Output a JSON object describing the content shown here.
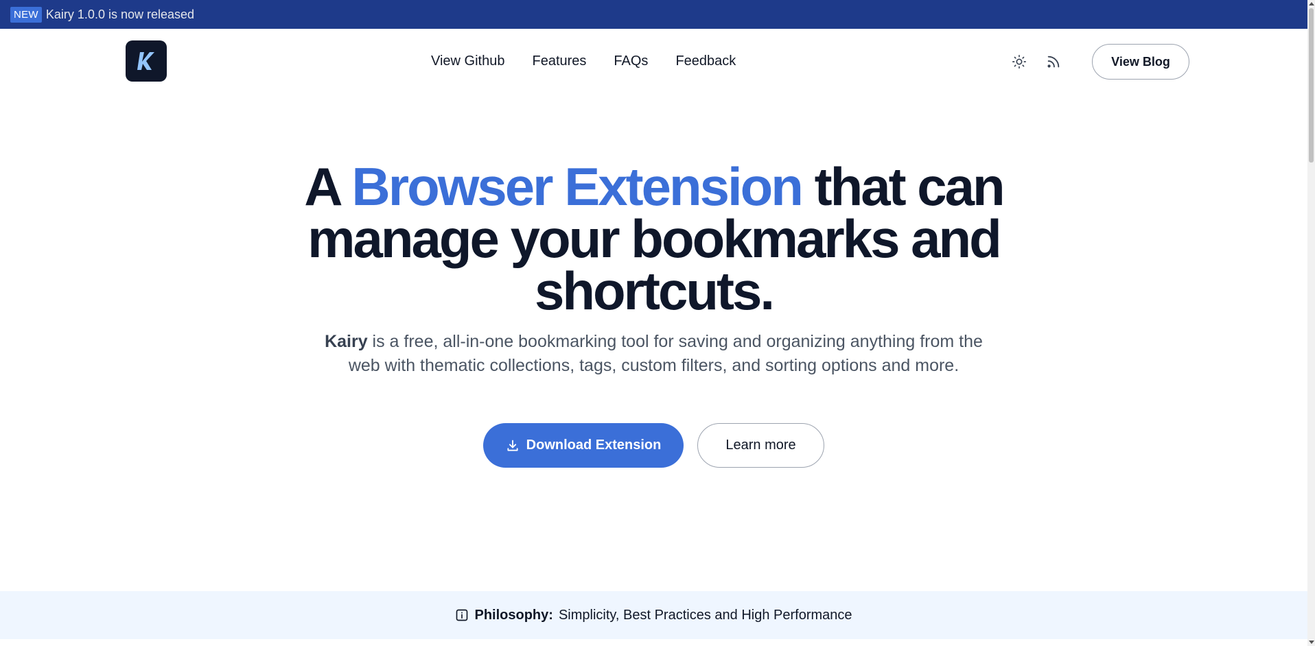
{
  "announcement": {
    "badge": "NEW",
    "text": "Kairy 1.0.0 is now released"
  },
  "nav": {
    "logo_letter": "K",
    "links": [
      "View Github",
      "Features",
      "FAQs",
      "Feedback"
    ],
    "icons": [
      "sun-icon",
      "rss-icon"
    ],
    "blog_button": "View Blog"
  },
  "hero": {
    "title_pre": "A ",
    "title_accent": "Browser Extension",
    "title_post": " that can manage your bookmarks and shortcuts.",
    "subtitle_brand": "Kairy",
    "subtitle_rest": " is a free, all-in-one bookmarking tool for saving and organizing anything from the web with thematic collections, tags, custom filters, and sorting options and more.",
    "primary_button": "Download Extension",
    "secondary_button": "Learn more"
  },
  "philosophy": {
    "label": "Philosophy:",
    "text": "Simplicity, Best Practices and High Performance"
  },
  "colors": {
    "accent": "#3b6fd8",
    "announcement_bg": "#1e3a8a",
    "dark": "#0f172a",
    "philosophy_bg": "#eff6ff"
  }
}
